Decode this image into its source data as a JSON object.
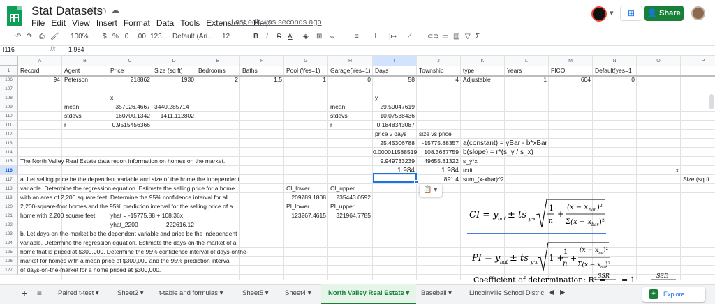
{
  "app": {
    "title": "Stat Datasets",
    "menu": [
      "File",
      "Edit",
      "View",
      "Insert",
      "Format",
      "Data",
      "Tools",
      "Extensions",
      "Help"
    ],
    "last_edit": "Last edit was seconds ago",
    "share_label": "Share",
    "brand_color": "#0f9d58",
    "share_color": "#188038",
    "accent_color": "#1a73e8"
  },
  "toolbar": {
    "zoom": "100%",
    "currency": "$",
    "percent": "%",
    "dec_decrease": ".0",
    "dec_increase": ".00",
    "format_more": "123",
    "font": "Default (Ari...",
    "font_size": "12",
    "bold": "B",
    "italic": "I",
    "strike": "S",
    "text_color": "A",
    "icons": [
      "undo-icon",
      "redo-icon",
      "print-icon",
      "paint-format-icon",
      "fill-color-icon",
      "borders-icon",
      "merge-icon",
      "align-icon",
      "valign-icon",
      "wrap-icon",
      "rotate-icon",
      "link-icon",
      "comment-icon",
      "chart-icon",
      "filter-icon",
      "functions-icon"
    ]
  },
  "formula_bar": {
    "name_box": "I116",
    "fx": "fx",
    "content": "1.984"
  },
  "columns": [
    "A",
    "B",
    "C",
    "D",
    "E",
    "F",
    "G",
    "H",
    "I",
    "J",
    "K",
    "L",
    "M",
    "N",
    "O",
    "P"
  ],
  "selected_column": "I",
  "rows": [
    "1",
    "106",
    "107",
    "108",
    "109",
    "110",
    "111",
    "112",
    "113",
    "114",
    "115",
    "116",
    "117",
    "118",
    "119",
    "120",
    "121",
    "122",
    "123",
    "124",
    "125",
    "126",
    "127"
  ],
  "selected_row": "116",
  "header_row": [
    "Record",
    "Agent",
    "Price",
    "Size (sq ft)",
    "Bedrooms",
    "Baths",
    "Pool (Yes=1)",
    "Garage(Yes=1)",
    "Days",
    "Township",
    "type",
    "Years",
    "FICO",
    "Default(yes=1"
  ],
  "row106": [
    "94",
    "Peterson",
    "218862",
    "1930",
    "2",
    "1.5",
    "1",
    "0",
    "58",
    "4",
    "Adjustable",
    "1",
    "604",
    "0"
  ],
  "cells": {
    "c108_x": "x",
    "c108_y": "y",
    "mean_label": "mean",
    "mean_price": "357026.4667",
    "mean_size": "3440.285714",
    "mean_label2": "mean",
    "mean_days": "29.59047619",
    "stdevs_label": "stdevs",
    "stdevs_price": "160700.1342",
    "stdevs_size": "1411.112802",
    "stdevs_label2": "stdevs",
    "stdevs_days": "10.07538436",
    "r_label": "r",
    "r_value": "0.9515456366",
    "r_label2": "r",
    "r_days": "0.1848343087",
    "price_v_days": "price v days",
    "size_vs_price": "size vs price'",
    "a_days": "25.45306788",
    "a_price": "-15775.88357",
    "a_formula": "a(constant) = yBar - b*xBar",
    "b_days": "0.000011588519",
    "b_price": "108.3637759",
    "b_formula": "b(slope) = r*(s_y / s_x)",
    "syx_days": "9.949733239",
    "syx_price": "49655.81322",
    "syx_label": "s_y*x",
    "intro": "The North Valley Real Estate data report information on homes on the market.",
    "tcrit_i": "1.984",
    "tcrit_j": "1.984",
    "tcrit_label": "tcrit",
    "x_label_o": "x",
    "sum_value": "891.4",
    "sum_label": "sum_(x-xbar)^2",
    "size_label_p": "Size (sq ft",
    "q_a": [
      "a. Let selling price be the dependent variable and size of the home the independent",
      "variable. Determine the regression equation. Estimate the selling price for a home",
      "with an area of 2,200 square feet. Determine the 95% confidence interval for all",
      "2,200-square-foot homes and the 95% prediction interval for the selling price of a",
      "home with 2,200 square feet."
    ],
    "yhat_eq": "yhat = -15775.88 + 108.36x",
    "yhat_label": "yhat_2200",
    "yhat_value": "222616.12",
    "ci_lower": "CI_lower",
    "ci_upper": "CI_upper",
    "ci_lower_v": "209789.1808",
    "ci_upper_v": "235443.0592",
    "pi_lower": "PI_lower",
    "pi_upper": "PI_upper",
    "pi_lower_v": "123267.4615",
    "pi_upper_v": "321964.7785",
    "q_b": [
      "b. Let days-on-the-market be the dependent variable and price be the independent",
      "variable. Determine the regression equation. Estimate the days-on-the-market of a",
      "home that is priced at $300,000. Determine the 95% confidence interval of days-onthe-",
      "market for homes with a mean price of $300,000 and the 95% prediction interval",
      "of days-on-the-market for a home priced at $300,000."
    ]
  },
  "formulas": {
    "ci": "CI = y_hat ± t s_y·x √( 1/n + (x − x_bar)² / Σ(x − x_bar)² )",
    "pi": "PI = y_hat ± t s_y·x √( 1 + 1/n + (x − x_bar)² / Σ(x − x_bar)² )",
    "r2_lead": "Coefficient of determination: R² = SSR / ... = 1 − SSE / ..."
  },
  "sheets": [
    "Paired t-test",
    "Sheet2",
    "t-table and formulas",
    "Sheet5",
    "Sheet4",
    "North Valley Real Estate",
    "Baseball",
    "Lincolnville School Distric"
  ],
  "active_sheet": "North Valley Real Estate",
  "explore_label": "Explore"
}
